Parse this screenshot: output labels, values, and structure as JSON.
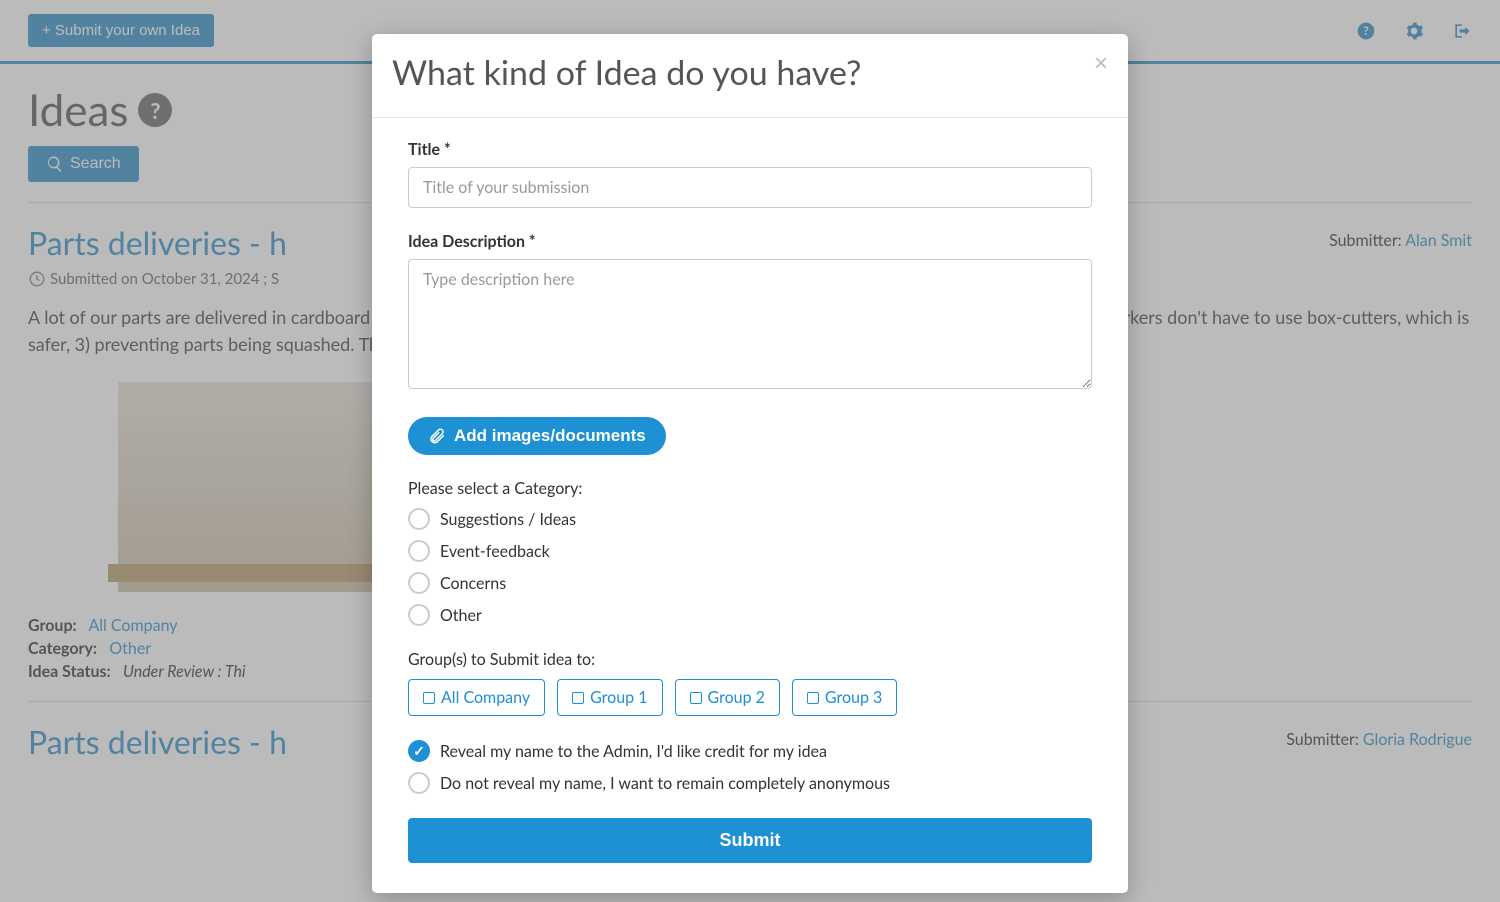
{
  "topbar": {
    "submit_label": "+ Submit your own Idea"
  },
  "page": {
    "title": "Ideas",
    "search_label": "Search"
  },
  "ideas": [
    {
      "title": "Parts deliveries - h",
      "submitter_label": "Submitter:",
      "submitter_name": "Alan Smit",
      "meta": "Submitted on October 31, 2024 ; S",
      "body": "A lot of our parts are delivered in cardboard boxes on pallets. Supplying the parts in stackable tubs will 1) save cardboard usage, 2) mean workers don't have to use box-cutters, which is safer, 3) preventing parts being squashed. The tubs only cost a little given the cardboard saving.",
      "group_label": "Group:",
      "group_value": "All Company",
      "category_label": "Category:",
      "category_value": "Other",
      "status_label": "Idea Status:",
      "status_value": "Under Review : Thi"
    },
    {
      "title": "Parts deliveries - h",
      "submitter_label": "Submitter:",
      "submitter_name": "Gloria Rodrigue"
    }
  ],
  "modal": {
    "title": "What kind of Idea do you have?",
    "close": "×",
    "title_label": "Title *",
    "title_placeholder": "Title of your submission",
    "desc_label": "Idea Description *",
    "desc_placeholder": "Type description here",
    "attach_label": "Add images/documents",
    "category_label": "Please select a Category:",
    "categories": [
      "Suggestions / Ideas",
      "Event-feedback",
      "Concerns",
      "Other"
    ],
    "groups_label": "Group(s) to Submit idea to:",
    "groups": [
      "All Company",
      "Group 1",
      "Group 2",
      "Group 3"
    ],
    "anonymity": {
      "reveal": "Reveal my name to the Admin, I'd like credit for my idea",
      "hide": "Do not reveal my name, I want to remain completely anonymous"
    },
    "submit_label": "Submit"
  }
}
